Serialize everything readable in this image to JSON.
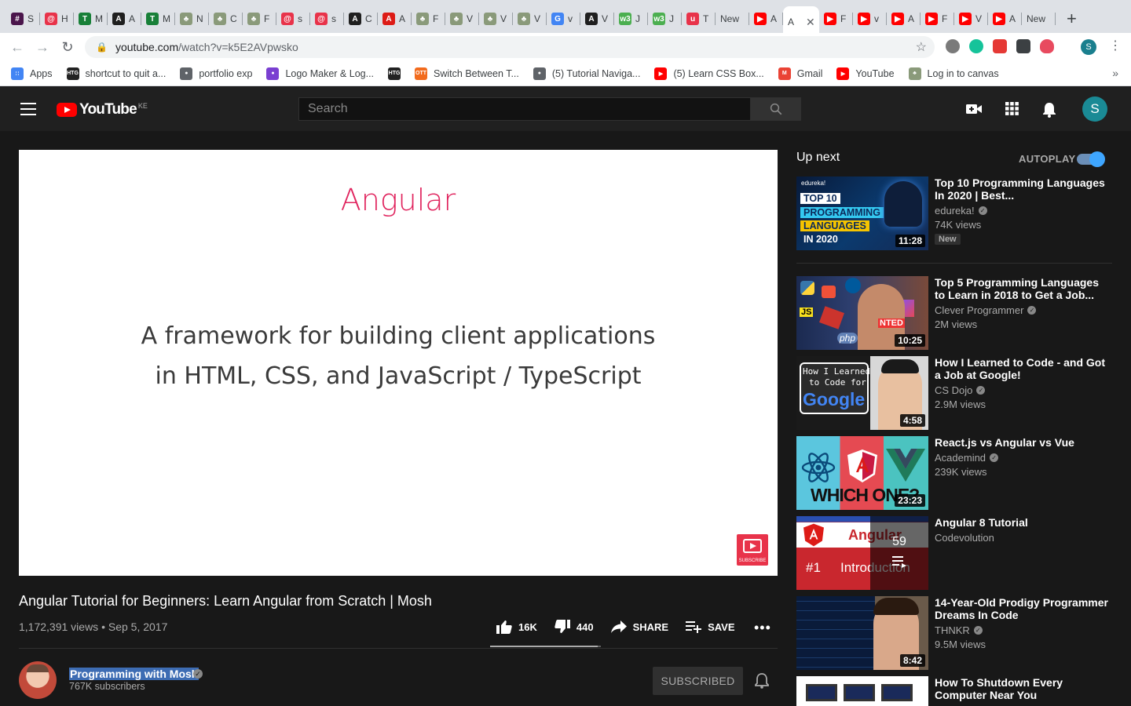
{
  "browser": {
    "tabs": [
      {
        "title": "S",
        "favicon": "slack-icon",
        "color": "#4a154b",
        "glyph": "#"
      },
      {
        "title": "H",
        "favicon": "codewars-icon",
        "color": "#e8334a",
        "glyph": "@"
      },
      {
        "title": "M",
        "favicon": "sheets-icon",
        "color": "#188038",
        "glyph": "T"
      },
      {
        "title": "A",
        "favicon": "angular-io-icon",
        "color": "#1f1f1f",
        "glyph": "A"
      },
      {
        "title": "M",
        "favicon": "sheets-icon",
        "color": "#188038",
        "glyph": "T"
      },
      {
        "title": "N",
        "favicon": "tree-icon",
        "color": "#8a9a7a",
        "glyph": "♣"
      },
      {
        "title": "C",
        "favicon": "tree-icon",
        "color": "#8a9a7a",
        "glyph": "♣"
      },
      {
        "title": "F",
        "favicon": "tree-icon",
        "color": "#8a9a7a",
        "glyph": "♣"
      },
      {
        "title": "s",
        "favicon": "codewars-icon",
        "color": "#e8334a",
        "glyph": "@"
      },
      {
        "title": "s",
        "favicon": "codewars-icon",
        "color": "#e8334a",
        "glyph": "@"
      },
      {
        "title": "C",
        "favicon": "angular-io-icon",
        "color": "#1f1f1f",
        "glyph": "A"
      },
      {
        "title": "A",
        "favicon": "angular-icon",
        "color": "#dd1b16",
        "glyph": "A"
      },
      {
        "title": "F",
        "favicon": "tree-icon",
        "color": "#8a9a7a",
        "glyph": "♣"
      },
      {
        "title": "V",
        "favicon": "tree-icon",
        "color": "#8a9a7a",
        "glyph": "♣"
      },
      {
        "title": "V",
        "favicon": "tree-icon",
        "color": "#8a9a7a",
        "glyph": "♣"
      },
      {
        "title": "V",
        "favicon": "tree-icon",
        "color": "#8a9a7a",
        "glyph": "♣"
      },
      {
        "title": "v",
        "favicon": "google-icon",
        "color": "#4285f4",
        "glyph": "G"
      },
      {
        "title": "V",
        "favicon": "angular-io-icon",
        "color": "#1f1f1f",
        "glyph": "A"
      },
      {
        "title": "J",
        "favicon": "w3schools-icon",
        "color": "#4caf50",
        "glyph": "w3"
      },
      {
        "title": "J",
        "favicon": "w3schools-icon",
        "color": "#4caf50",
        "glyph": "w3"
      },
      {
        "title": "T",
        "favicon": "udemy-icon",
        "color": "#e8334a",
        "glyph": "u"
      },
      {
        "title": "New",
        "favicon": "",
        "color": "",
        "glyph": ""
      },
      {
        "title": "A",
        "favicon": "youtube-icon",
        "color": "#ff0000",
        "glyph": "▶"
      }
    ],
    "active_tab": {
      "title": "A",
      "favicon": "",
      "close": "✕"
    },
    "tabs_right": [
      {
        "title": "F",
        "favicon": "youtube-icon",
        "color": "#ff0000",
        "glyph": "▶"
      },
      {
        "title": "v",
        "favicon": "youtube-icon",
        "color": "#ff0000",
        "glyph": "▶"
      },
      {
        "title": "A",
        "favicon": "youtube-icon",
        "color": "#ff0000",
        "glyph": "▶"
      },
      {
        "title": "F",
        "favicon": "youtube-icon",
        "color": "#ff0000",
        "glyph": "▶"
      },
      {
        "title": "V",
        "favicon": "youtube-icon",
        "color": "#ff0000",
        "glyph": "▶"
      },
      {
        "title": "A",
        "favicon": "youtube-icon",
        "color": "#ff0000",
        "glyph": "▶"
      },
      {
        "title": "New",
        "favicon": "",
        "color": "",
        "glyph": ""
      }
    ],
    "new_tab_symbol": "+",
    "url_host": "youtube.com",
    "url_path": "/watch?v=k5E2AVpwsko",
    "profile_initial": "S",
    "bookmarks": [
      {
        "label": "Apps",
        "icon": "apps-grid-icon",
        "color": "#4285f4",
        "glyph": "∷"
      },
      {
        "label": "shortcut to quit a...",
        "icon": "htg-icon",
        "color": "#222",
        "glyph": "HTG"
      },
      {
        "label": "portfolio exp",
        "icon": "globe-icon",
        "color": "#5f6368",
        "glyph": "●"
      },
      {
        "label": "Logo Maker & Log...",
        "icon": "logomaker-icon",
        "color": "#7a3fd1",
        "glyph": "●"
      },
      {
        "label": "",
        "icon": "htg-icon",
        "color": "#222",
        "glyph": "HTG"
      },
      {
        "label": "Switch Between T...",
        "icon": "ott-icon",
        "color": "#f26b1d",
        "glyph": "OTT"
      },
      {
        "label": "(5) Tutorial Naviga...",
        "icon": "globe-icon",
        "color": "#5f6368",
        "glyph": "●"
      },
      {
        "label": "(5) Learn CSS Box...",
        "icon": "youtube-icon",
        "color": "#ff0000",
        "glyph": "▶"
      },
      {
        "label": "Gmail",
        "icon": "gmail-icon",
        "color": "#ea4335",
        "glyph": "M"
      },
      {
        "label": "YouTube",
        "icon": "youtube-icon",
        "color": "#ff0000",
        "glyph": "▶"
      },
      {
        "label": "Log in to canvas",
        "icon": "tree-icon",
        "color": "#8a9a7a",
        "glyph": "♣"
      }
    ],
    "bookmarks_more": "»"
  },
  "youtube": {
    "logo_word": "YouTube",
    "country_code": "KE",
    "search_placeholder": "Search",
    "user_initial": "S",
    "video": {
      "slide_title": "Angular",
      "slide_line1": "A framework for building client applications",
      "slide_line2": "in HTML, CSS, and JavaScript / TypeScript",
      "subscribe_badge": "SUBSCRIBE",
      "title": "Angular Tutorial for Beginners: Learn Angular from Scratch | Mosh",
      "meta": "1,172,391 views • Sep 5, 2017",
      "likes": "16K",
      "dislikes": "440",
      "like_ratio": 0.973,
      "share": "SHARE",
      "save": "SAVE",
      "more": "•••"
    },
    "channel": {
      "name": "Programming with Mosh",
      "subscribers": "767K subscribers",
      "subscribed_label": "SUBSCRIBED",
      "verified": "✓"
    },
    "sidebar": {
      "up_next": "Up next",
      "autoplay": "AUTOPLAY",
      "autoplay_on": true,
      "items": [
        {
          "title": "Top 10 Programming Languages In 2020 | Best...",
          "channel": "edureka!",
          "verified": true,
          "views": "74K views",
          "badge": "New",
          "duration": "11:28",
          "thumb_text": [
            "edureka!",
            "TOP 10",
            "PROGRAMMING",
            "LANGUAGES",
            "IN 2020"
          ]
        },
        {
          "title": "Top 5 Programming Languages to Learn in 2018 to Get a Job...",
          "channel": "Clever Programmer",
          "verified": true,
          "views": "2M views",
          "duration": "10:25",
          "thumb_text": [
            "JS",
            "php",
            "NTED"
          ]
        },
        {
          "title": "How I Learned to Code - and Got a Job at Google!",
          "channel": "CS Dojo",
          "verified": true,
          "views": "2.9M views",
          "duration": "4:58",
          "thumb_text": [
            "How I Learned",
            "to Code for",
            "Google"
          ]
        },
        {
          "title": "React.js vs Angular vs Vue",
          "channel": "Academind",
          "verified": true,
          "views": "239K views",
          "duration": "23:23",
          "thumb_text": [
            "WHICH ONE?"
          ]
        },
        {
          "title": "Angular 8 Tutorial",
          "channel": "Codevolution",
          "verified": false,
          "views": "",
          "playlist_count": "59",
          "thumb_text": [
            "Angular",
            "#1",
            "Introduction"
          ]
        },
        {
          "title": "14-Year-Old Prodigy Programmer Dreams In Code",
          "channel": "THNKR",
          "verified": true,
          "views": "9.5M views",
          "duration": "8:42",
          "thumb_text": []
        },
        {
          "title": "How To Shutdown Every Computer Near You",
          "channel": "",
          "verified": false,
          "views": "",
          "duration": "",
          "thumb_text": []
        }
      ]
    }
  }
}
